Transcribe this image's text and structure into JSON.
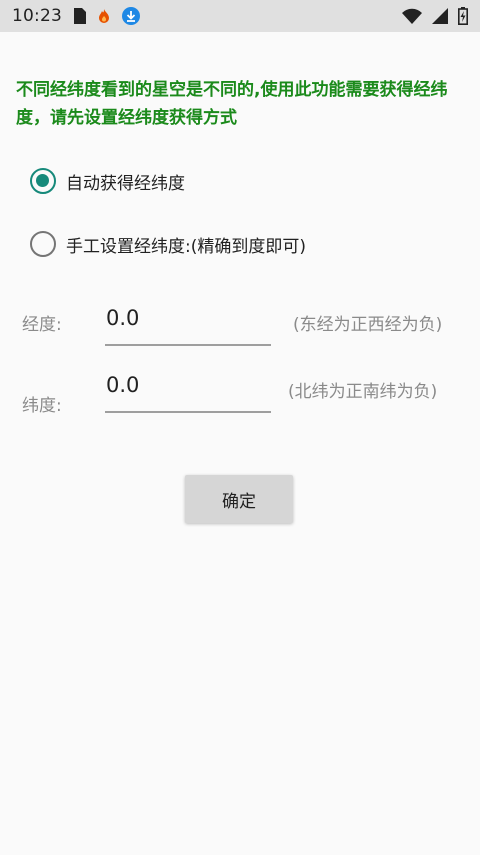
{
  "status_bar": {
    "time": "10:23",
    "left_icons": [
      "sim-card-icon",
      "flame-icon",
      "download-icon"
    ],
    "right_icons": [
      "wifi-icon",
      "signal-icon",
      "battery-charging-icon"
    ],
    "download_icon_color": "#1e88e5",
    "flame_icon_color": "#e65100"
  },
  "notice": {
    "text": "不同经纬度看到的星空是不同的,使用此功能需要获得经纬度，请先设置经纬度获得方式",
    "color": "#1b8a1b"
  },
  "options": [
    {
      "label": "自动获得经纬度",
      "checked": true
    },
    {
      "label": "手工设置经纬度:(精确到度即可)",
      "checked": false
    }
  ],
  "accent_color": "#16897a",
  "longitude": {
    "label": "经度:",
    "value": "0.0",
    "hint": "(东经为正西经为负)"
  },
  "latitude": {
    "label": "纬度:",
    "value": "0.0",
    "hint": "(北纬为正南纬为负)"
  },
  "confirm_label": "确定"
}
